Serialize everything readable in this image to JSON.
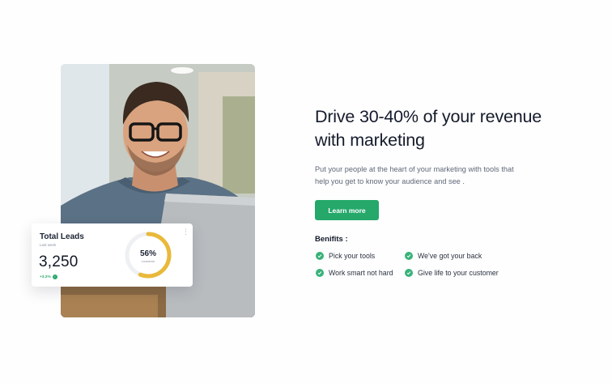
{
  "hero": {
    "headline": "Drive 30-40% of your revenue with marketing",
    "description": "Put your people at the heart of your marketing with tools that help you get to know your audience and see .",
    "cta_label": "Learn more",
    "benefits_heading": "Benifits :",
    "benefits": [
      {
        "label": "Pick your tools",
        "icon": "check-circle-icon"
      },
      {
        "label": "We've got your back",
        "icon": "check-circle-icon"
      },
      {
        "label": "Work smart not hard",
        "icon": "check-circle-icon"
      },
      {
        "label": "Give life to your customer",
        "icon": "check-circle-icon"
      }
    ]
  },
  "leads_card": {
    "title": "Total Leads",
    "period": "Last week",
    "value": "3,250",
    "change": "+3.2%",
    "donut_percent_label": "56%",
    "donut_percent": 56,
    "donut_caption": "Leads/ok"
  },
  "colors": {
    "accent_green": "#26a86b",
    "donut_yellow": "#e9b93a",
    "donut_track": "#eef0f3",
    "text_dark": "#141b2b"
  },
  "photo": {
    "subject": "smiling man with glasses at laptop"
  }
}
